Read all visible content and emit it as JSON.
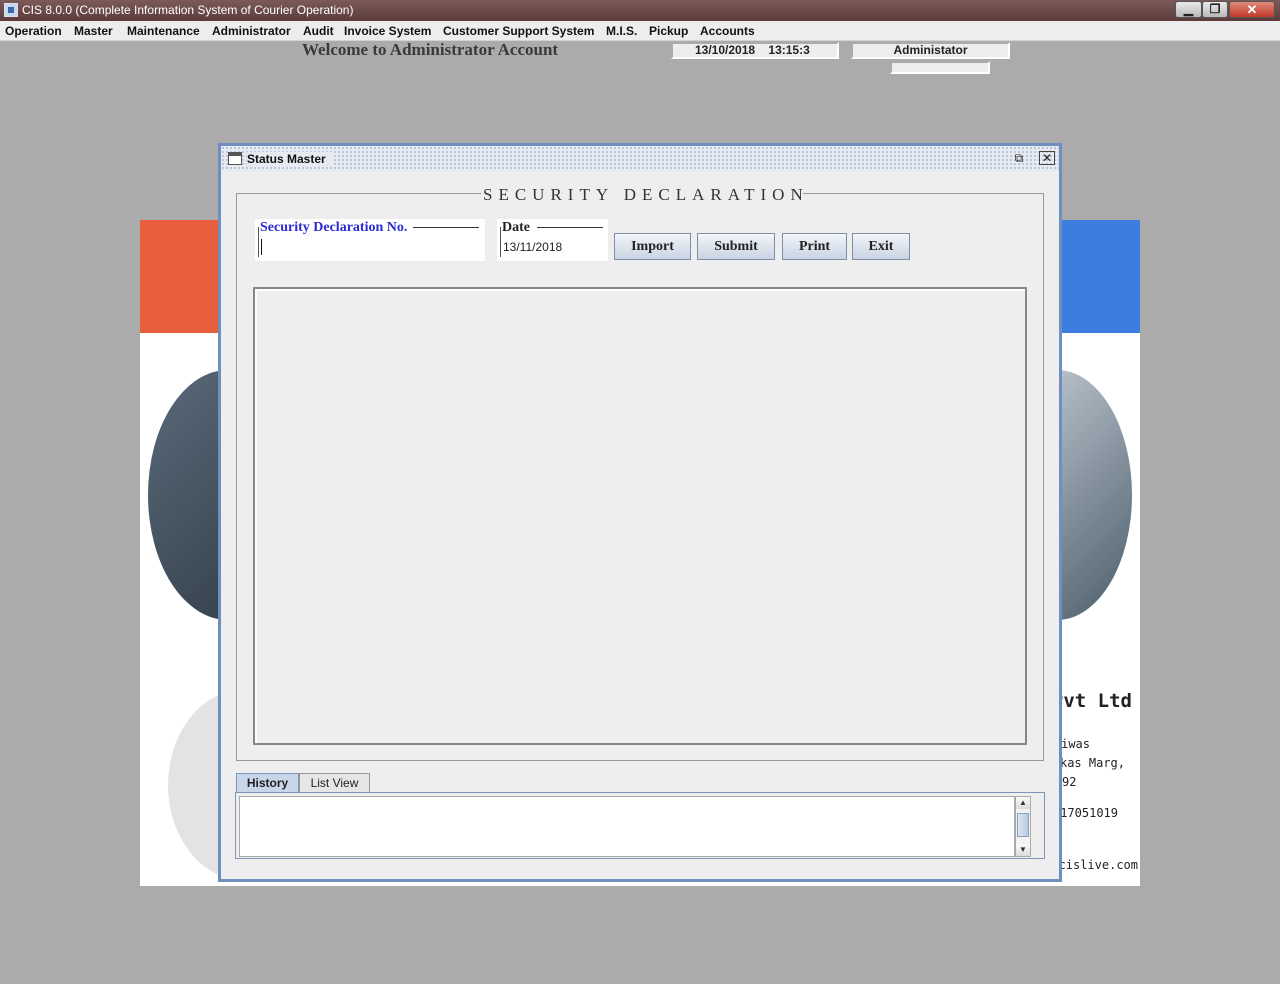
{
  "window": {
    "title": "CIS 8.0.0 (Complete Information System of Courier Operation)",
    "minimize_glyph": "▁",
    "maximize_glyph": "❐",
    "close_glyph": "✕"
  },
  "menu": [
    {
      "label": "Operation"
    },
    {
      "label": "Master"
    },
    {
      "label": "Maintenance"
    },
    {
      "label": "Administrator"
    },
    {
      "label": "Audit"
    },
    {
      "label": "Invoice System"
    },
    {
      "label": "Customer Support System"
    },
    {
      "label": "M.I.S."
    },
    {
      "label": "Pickup"
    },
    {
      "label": "Accounts"
    }
  ],
  "header": {
    "welcome": "Welcome to Administrator Account",
    "date": "13/10/2018",
    "time": "13:15:3",
    "user": "Administator"
  },
  "background": {
    "company": "s Pvt Ltd",
    "address_line1": "hdeva Niwas",
    "address_line2": "d Vikas Marg,",
    "address_line3": "92",
    "phone": "17051019",
    "email": "t@cislive.com"
  },
  "frame": {
    "title": "Status Master",
    "restore_glyph": "⧉",
    "close_glyph": "✕"
  },
  "form": {
    "legend": "SECURITY DECLARATION",
    "sd_label": "Security Declaration No.",
    "sd_value": "",
    "date_label": "Date",
    "date_value": "13/11/2018",
    "buttons": {
      "import": "Import",
      "submit": "Submit",
      "print": "Print",
      "exit": "Exit"
    }
  },
  "tabs": {
    "history": "History",
    "list_view": "List View"
  },
  "icons": {
    "scroll_up": "▲",
    "scroll_down": "▼"
  }
}
